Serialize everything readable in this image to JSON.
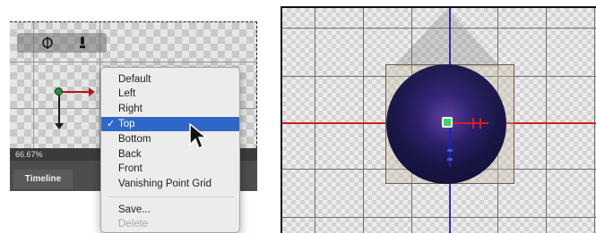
{
  "left_panel": {
    "zoom": "66.67%",
    "timeline_tab": "Timeline",
    "toolbar_icons": [
      "rotate-3d-icon",
      "light-icon"
    ]
  },
  "view_menu": {
    "items": [
      {
        "label": "Default"
      },
      {
        "label": "Left"
      },
      {
        "label": "Right"
      },
      {
        "label": "Top",
        "checked": true
      },
      {
        "label": "Bottom"
      },
      {
        "label": "Back"
      },
      {
        "label": "Front"
      },
      {
        "label": "Vanishing Point Grid"
      }
    ],
    "check_mark": "✓",
    "save_label": "Save...",
    "delete_label": "Delete",
    "selected_color": "#2f67c9"
  },
  "viewport": {
    "x_axis_color": "#d02020",
    "y_axis_color": "#3a2ca8",
    "object_type": "sphere"
  }
}
